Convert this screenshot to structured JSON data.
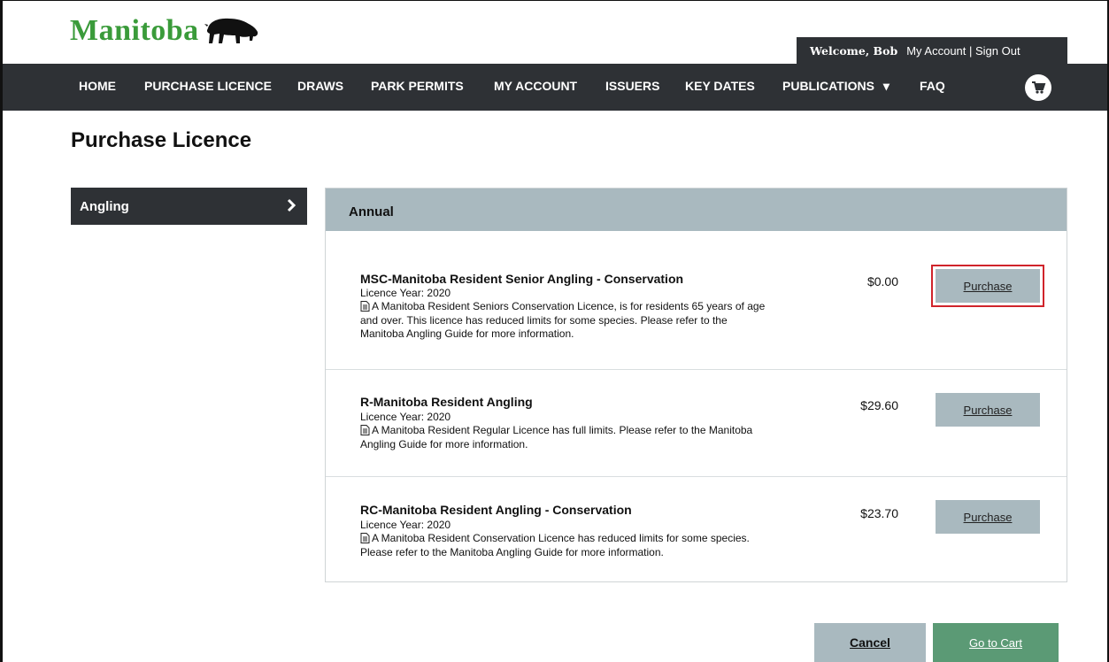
{
  "brand": {
    "name": "Manitoba",
    "color": "#3a9b3a"
  },
  "header": {
    "welcome": "Welcome, Bob",
    "links": "My Account | Sign Out"
  },
  "nav": {
    "items": [
      "HOME",
      "PURCHASE LICENCE",
      "DRAWS",
      "PARK PERMITS",
      "MY ACCOUNT",
      "ISSUERS",
      "KEY DATES",
      "PUBLICATIONS",
      "FAQ"
    ],
    "publications_caret": "▾",
    "cart_icon": "cart-icon"
  },
  "page": {
    "title": "Purchase Licence"
  },
  "sidebar": {
    "items": [
      {
        "label": "Angling",
        "icon": "chevron-right-icon"
      }
    ]
  },
  "panel": {
    "header": "Annual",
    "licences": [
      {
        "name": "MSC-Manitoba Resident Senior Angling - Conservation",
        "year": "Licence Year: 2020",
        "description": "A Manitoba Resident Seniors Conservation Licence, is for residents 65 years of age and over. This licence has reduced limits for some species. Please refer to the Manitoba Angling Guide for more information.",
        "price": "$0.00",
        "button": "Purchase",
        "highlighted": true
      },
      {
        "name": "R-Manitoba Resident Angling",
        "year": "Licence Year: 2020",
        "description": "A Manitoba Resident Regular Licence has full limits. Please refer to the Manitoba Angling Guide for more information.",
        "price": "$29.60",
        "button": "Purchase",
        "highlighted": false
      },
      {
        "name": "RC-Manitoba Resident Angling - Conservation",
        "year": "Licence Year: 2020",
        "description": "A Manitoba Resident Conservation Licence has reduced limits for some species. Please refer to the Manitoba Angling Guide for more information.",
        "price": "$23.70",
        "button": "Purchase",
        "highlighted": false
      }
    ]
  },
  "footer": {
    "cancel": "Cancel",
    "go_to_cart": "Go to Cart"
  },
  "colors": {
    "nav_bg": "#2e3135",
    "button_grey": "#a9b9bf",
    "cart_green": "#5b9a75",
    "highlight_red": "#d0242b"
  }
}
